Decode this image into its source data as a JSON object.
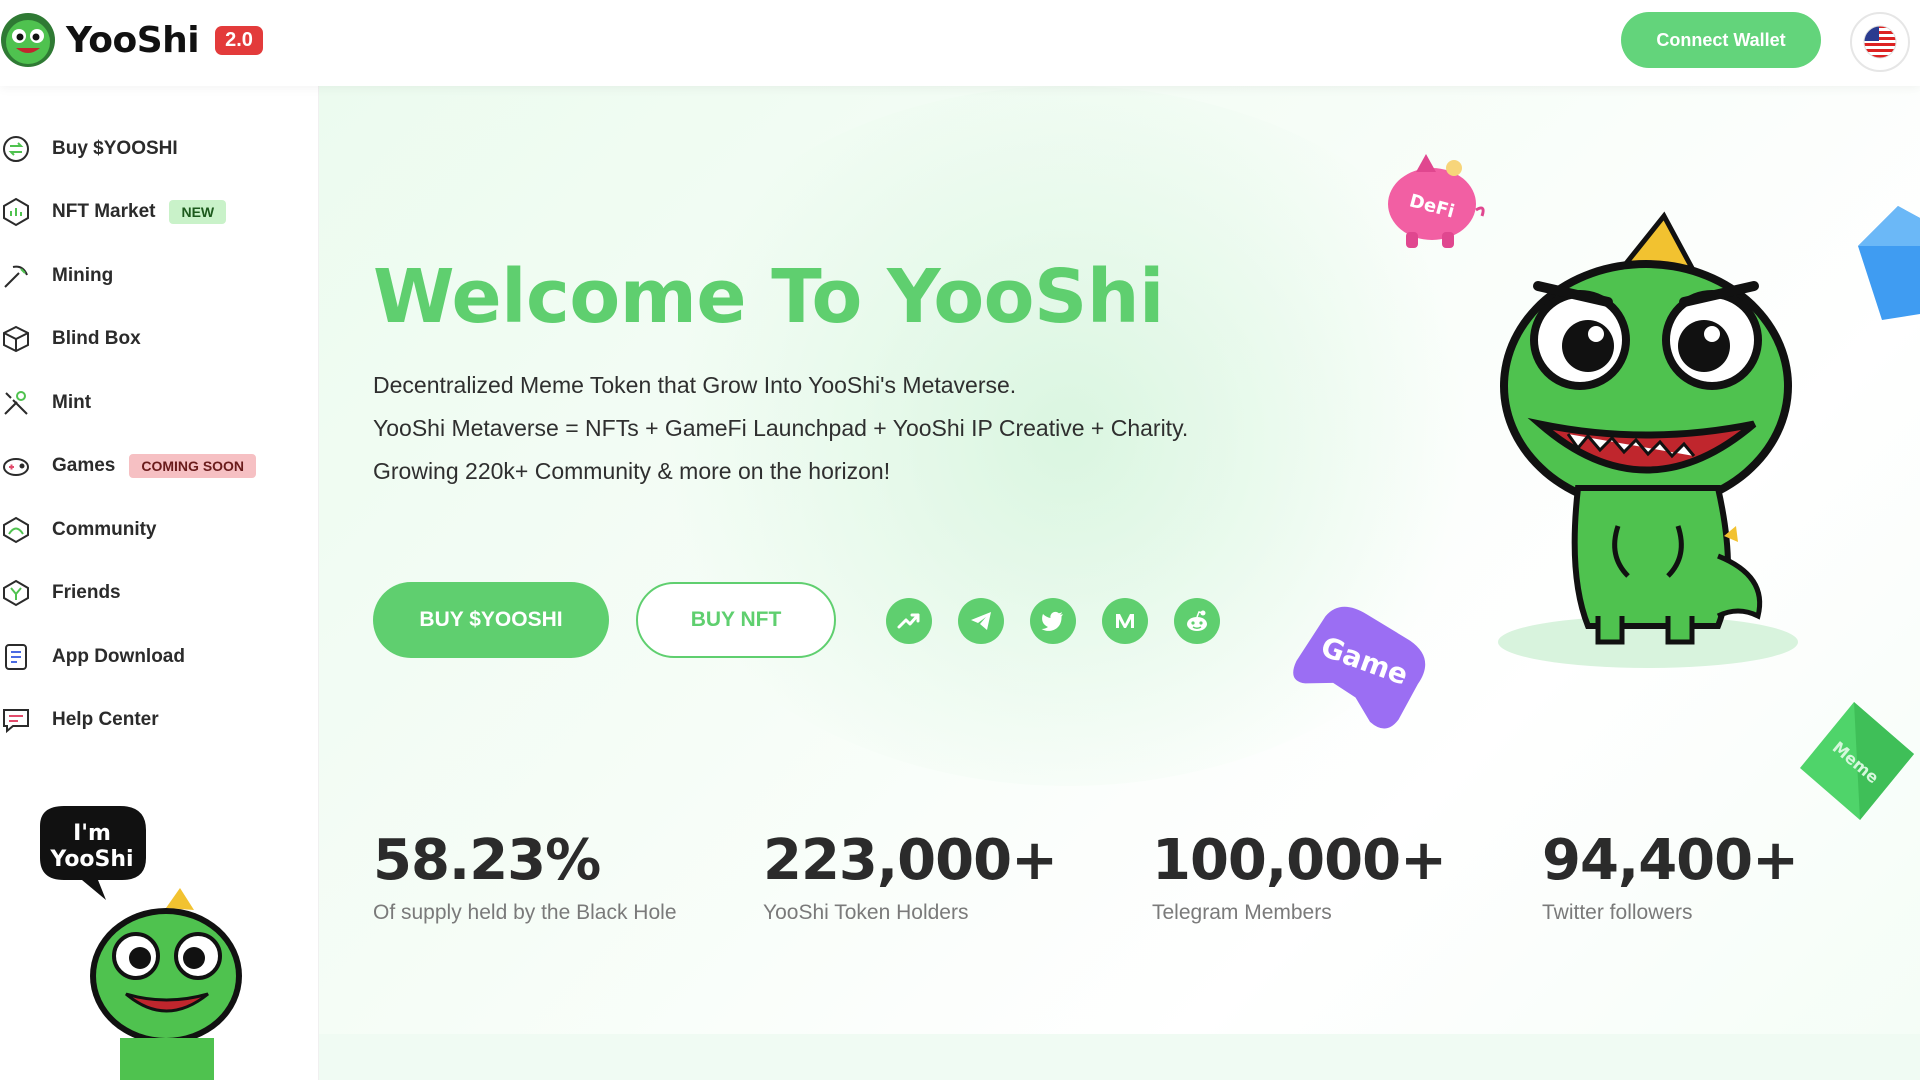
{
  "header": {
    "logo_text": "YooShi",
    "version": "2.0",
    "connect_wallet": "Connect Wallet",
    "language_icon": "us-flag-icon"
  },
  "sidebar": {
    "items": [
      {
        "label": "Buy $YOOSHI",
        "icon": "swap-circle-icon"
      },
      {
        "label": "NFT Market",
        "icon": "chart-hexagon-icon",
        "badge": "NEW"
      },
      {
        "label": "Mining",
        "icon": "pickaxe-icon"
      },
      {
        "label": "Blind Box",
        "icon": "box-icon"
      },
      {
        "label": "Mint",
        "icon": "tools-icon"
      },
      {
        "label": "Games",
        "icon": "gamepad-icon",
        "badge": "COMING SOON"
      },
      {
        "label": "Community",
        "icon": "community-icon"
      },
      {
        "label": "Friends",
        "icon": "friends-icon"
      },
      {
        "label": "App Download",
        "icon": "phone-icon"
      },
      {
        "label": "Help Center",
        "icon": "chat-icon"
      }
    ],
    "mascot_bubble": [
      "I'm",
      "YooShi"
    ]
  },
  "hero": {
    "title": "Welcome To YooShi",
    "lines": [
      "Decentralized Meme Token that Grow Into YooShi's Metaverse.",
      "YooShi Metaverse = NFTs + GameFi Launchpad + YooShi IP Creative + Charity.",
      "Growing 220k+ Community & more on the horizon!"
    ],
    "buy_button": "BUY $YOOSHI",
    "nft_button": "BUY NFT",
    "socials": [
      "chart-trend-icon",
      "telegram-icon",
      "twitter-icon",
      "medium-icon",
      "reddit-icon"
    ],
    "deco_labels": {
      "defi": "DeFi",
      "game": "Game",
      "meme": "Meme"
    }
  },
  "stats": [
    {
      "value": "58.23%",
      "label": "Of supply held by the Black Hole"
    },
    {
      "value": "223,000+",
      "label": "YooShi Token Holders"
    },
    {
      "value": "100,000+",
      "label": "Telegram Members"
    },
    {
      "value": "94,400+",
      "label": "Twitter followers"
    }
  ],
  "colors": {
    "accent": "#5fcf6f",
    "badge_new_bg": "#c9f2c9",
    "badge_soon_bg": "#f6c0c3",
    "version_badge": "#e33b3b"
  }
}
